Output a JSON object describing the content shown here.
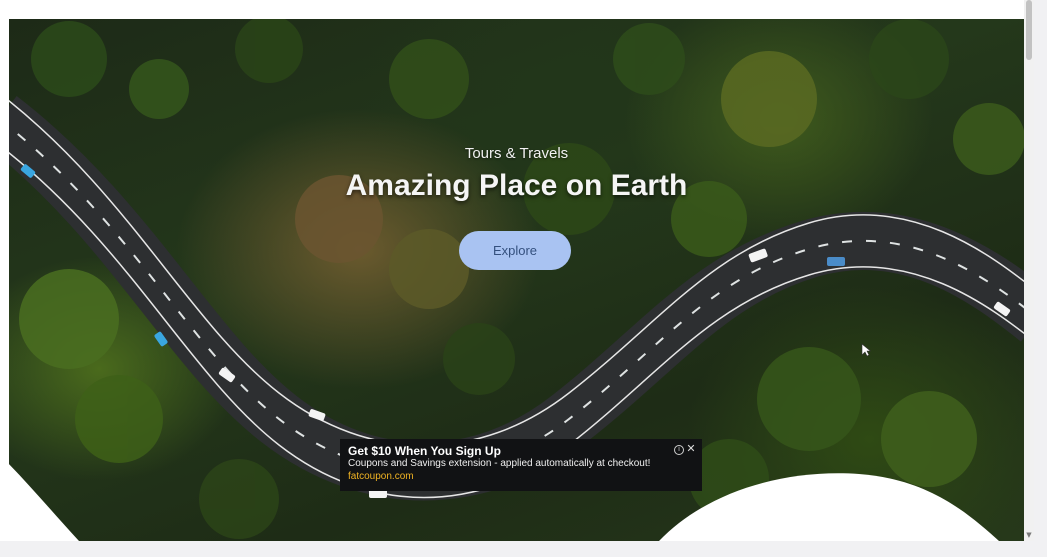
{
  "hero": {
    "eyebrow": "Tours & Travels",
    "title": "Amazing Place on Earth",
    "explore_label": "Explore"
  },
  "ad": {
    "title": "Get $10 When You Sign Up",
    "description": "Coupons and Savings extension - applied automatically at checkout!",
    "link": "fatcoupon.com",
    "info_icon": "info-icon",
    "close_icon": "close-icon"
  },
  "colors": {
    "button_bg": "#a9c3f2",
    "button_text": "#34507e",
    "ad_bg": "#111214",
    "ad_link": "#f0b323"
  }
}
